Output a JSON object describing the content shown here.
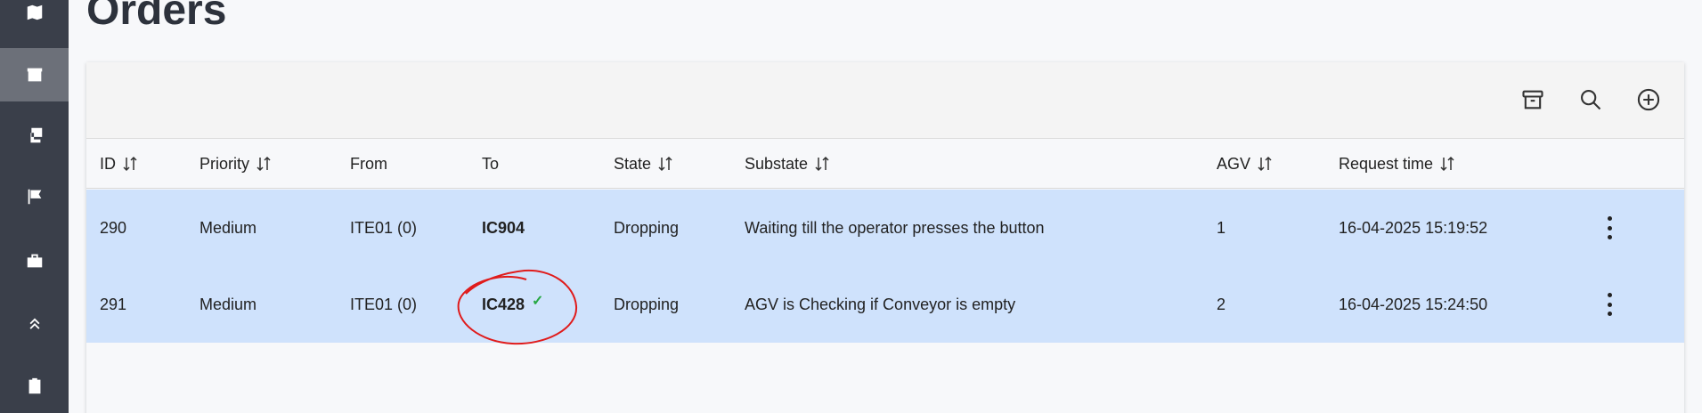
{
  "page": {
    "title": "Orders"
  },
  "sidebar": {
    "items": [
      {
        "icon": "map-icon"
      },
      {
        "icon": "box-icon",
        "active": true
      },
      {
        "icon": "stack-icon"
      },
      {
        "icon": "flag-icon"
      },
      {
        "icon": "briefcase-icon"
      },
      {
        "icon": "double-chevron-up-icon"
      },
      {
        "icon": "clipboard-icon"
      }
    ]
  },
  "toolbar": {
    "buttons": [
      "archive-icon",
      "search-icon",
      "add-circle-icon"
    ]
  },
  "table": {
    "columns": [
      "ID",
      "Priority",
      "From",
      "To",
      "State",
      "Substate",
      "AGV",
      "Request time"
    ],
    "sortable": [
      "ID",
      "Priority",
      "State",
      "Substate",
      "AGV",
      "Request time"
    ],
    "rows": [
      {
        "id": "290",
        "priority": "Medium",
        "from": "ITE01 (0)",
        "to": "IC904",
        "state": "Dropping",
        "substate": "Waiting till the operator presses the button",
        "agv": "1",
        "request_time": "16-04-2025 15:19:52",
        "checked": false
      },
      {
        "id": "291",
        "priority": "Medium",
        "from": "ITE01 (0)",
        "to": "IC428",
        "state": "Dropping",
        "substate": "AGV is Checking if Conveyor is empty",
        "agv": "2",
        "request_time": "16-04-2025 15:24:50",
        "checked": true
      }
    ]
  },
  "colors": {
    "sidebar_bg": "#3a3f4a",
    "sidebar_active": "#6c7079",
    "row_selected": "#cfe2fc",
    "check": "#27a844",
    "annotation": "#e01b1b"
  }
}
